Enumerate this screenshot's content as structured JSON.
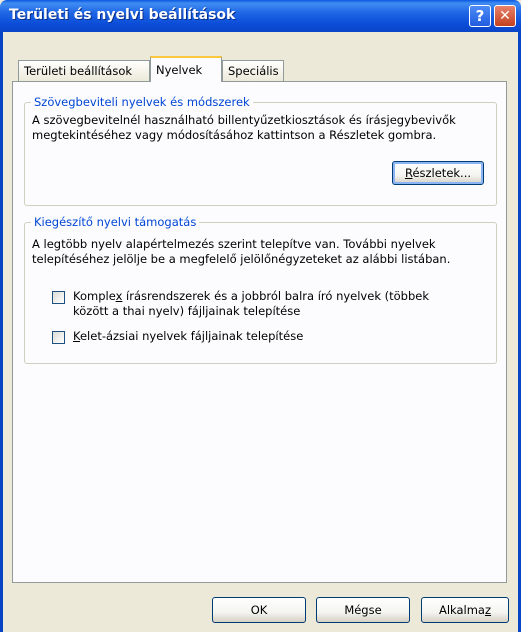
{
  "window": {
    "title": "Területi és nyelvi beállítások",
    "help_glyph": "?",
    "close_glyph": "✕"
  },
  "tabs": [
    {
      "label": "Területi beállítások",
      "active": false
    },
    {
      "label": "Nyelvek",
      "active": true
    },
    {
      "label": "Speciális",
      "active": false
    }
  ],
  "text_services": {
    "legend": "Szövegbeviteli nyelvek és módszerek",
    "description_line1": "A szövegbevitelnél használható billentyűzetkiosztások és írásjegybevivők",
    "description_line2": "megtekintéséhez vagy módosításához kattintson a Részletek gombra.",
    "details_button": {
      "mnemonic": "R",
      "rest": "észletek..."
    }
  },
  "supplemental": {
    "legend": "Kiegészítő nyelvi támogatás",
    "description_line1": "A legtöbb nyelv alapértelmezés szerint telepítve van. További nyelvek",
    "description_line2": "telepítéséhez jelölje be a megfelelő jelölőnégyzeteket az alábbi listában.",
    "complex_scripts": {
      "checked": false,
      "line1_pre": "Komple",
      "line1_mnemonic": "x",
      "line1_post": " írásrendszerek és a jobbról balra író nyelvek (többek",
      "line2": "között a thai nyelv) fájljainak telepítése"
    },
    "east_asian": {
      "checked": false,
      "mnemonic": "K",
      "rest": "elet-ázsiai nyelvek fájljainak telepítése"
    }
  },
  "buttons": {
    "ok": "OK",
    "cancel": "Mégse",
    "apply_pre": "Alkalma",
    "apply_mnemonic": "z"
  }
}
